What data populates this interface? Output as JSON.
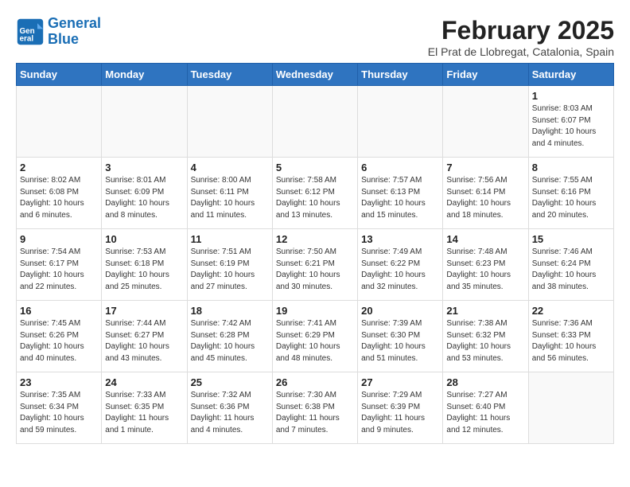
{
  "header": {
    "logo_line1": "General",
    "logo_line2": "Blue",
    "title": "February 2025",
    "subtitle": "El Prat de Llobregat, Catalonia, Spain"
  },
  "days_of_week": [
    "Sunday",
    "Monday",
    "Tuesday",
    "Wednesday",
    "Thursday",
    "Friday",
    "Saturday"
  ],
  "weeks": [
    [
      {
        "day": "",
        "info": ""
      },
      {
        "day": "",
        "info": ""
      },
      {
        "day": "",
        "info": ""
      },
      {
        "day": "",
        "info": ""
      },
      {
        "day": "",
        "info": ""
      },
      {
        "day": "",
        "info": ""
      },
      {
        "day": "1",
        "info": "Sunrise: 8:03 AM\nSunset: 6:07 PM\nDaylight: 10 hours\nand 4 minutes."
      }
    ],
    [
      {
        "day": "2",
        "info": "Sunrise: 8:02 AM\nSunset: 6:08 PM\nDaylight: 10 hours\nand 6 minutes."
      },
      {
        "day": "3",
        "info": "Sunrise: 8:01 AM\nSunset: 6:09 PM\nDaylight: 10 hours\nand 8 minutes."
      },
      {
        "day": "4",
        "info": "Sunrise: 8:00 AM\nSunset: 6:11 PM\nDaylight: 10 hours\nand 11 minutes."
      },
      {
        "day": "5",
        "info": "Sunrise: 7:58 AM\nSunset: 6:12 PM\nDaylight: 10 hours\nand 13 minutes."
      },
      {
        "day": "6",
        "info": "Sunrise: 7:57 AM\nSunset: 6:13 PM\nDaylight: 10 hours\nand 15 minutes."
      },
      {
        "day": "7",
        "info": "Sunrise: 7:56 AM\nSunset: 6:14 PM\nDaylight: 10 hours\nand 18 minutes."
      },
      {
        "day": "8",
        "info": "Sunrise: 7:55 AM\nSunset: 6:16 PM\nDaylight: 10 hours\nand 20 minutes."
      }
    ],
    [
      {
        "day": "9",
        "info": "Sunrise: 7:54 AM\nSunset: 6:17 PM\nDaylight: 10 hours\nand 22 minutes."
      },
      {
        "day": "10",
        "info": "Sunrise: 7:53 AM\nSunset: 6:18 PM\nDaylight: 10 hours\nand 25 minutes."
      },
      {
        "day": "11",
        "info": "Sunrise: 7:51 AM\nSunset: 6:19 PM\nDaylight: 10 hours\nand 27 minutes."
      },
      {
        "day": "12",
        "info": "Sunrise: 7:50 AM\nSunset: 6:21 PM\nDaylight: 10 hours\nand 30 minutes."
      },
      {
        "day": "13",
        "info": "Sunrise: 7:49 AM\nSunset: 6:22 PM\nDaylight: 10 hours\nand 32 minutes."
      },
      {
        "day": "14",
        "info": "Sunrise: 7:48 AM\nSunset: 6:23 PM\nDaylight: 10 hours\nand 35 minutes."
      },
      {
        "day": "15",
        "info": "Sunrise: 7:46 AM\nSunset: 6:24 PM\nDaylight: 10 hours\nand 38 minutes."
      }
    ],
    [
      {
        "day": "16",
        "info": "Sunrise: 7:45 AM\nSunset: 6:26 PM\nDaylight: 10 hours\nand 40 minutes."
      },
      {
        "day": "17",
        "info": "Sunrise: 7:44 AM\nSunset: 6:27 PM\nDaylight: 10 hours\nand 43 minutes."
      },
      {
        "day": "18",
        "info": "Sunrise: 7:42 AM\nSunset: 6:28 PM\nDaylight: 10 hours\nand 45 minutes."
      },
      {
        "day": "19",
        "info": "Sunrise: 7:41 AM\nSunset: 6:29 PM\nDaylight: 10 hours\nand 48 minutes."
      },
      {
        "day": "20",
        "info": "Sunrise: 7:39 AM\nSunset: 6:30 PM\nDaylight: 10 hours\nand 51 minutes."
      },
      {
        "day": "21",
        "info": "Sunrise: 7:38 AM\nSunset: 6:32 PM\nDaylight: 10 hours\nand 53 minutes."
      },
      {
        "day": "22",
        "info": "Sunrise: 7:36 AM\nSunset: 6:33 PM\nDaylight: 10 hours\nand 56 minutes."
      }
    ],
    [
      {
        "day": "23",
        "info": "Sunrise: 7:35 AM\nSunset: 6:34 PM\nDaylight: 10 hours\nand 59 minutes."
      },
      {
        "day": "24",
        "info": "Sunrise: 7:33 AM\nSunset: 6:35 PM\nDaylight: 11 hours\nand 1 minute."
      },
      {
        "day": "25",
        "info": "Sunrise: 7:32 AM\nSunset: 6:36 PM\nDaylight: 11 hours\nand 4 minutes."
      },
      {
        "day": "26",
        "info": "Sunrise: 7:30 AM\nSunset: 6:38 PM\nDaylight: 11 hours\nand 7 minutes."
      },
      {
        "day": "27",
        "info": "Sunrise: 7:29 AM\nSunset: 6:39 PM\nDaylight: 11 hours\nand 9 minutes."
      },
      {
        "day": "28",
        "info": "Sunrise: 7:27 AM\nSunset: 6:40 PM\nDaylight: 11 hours\nand 12 minutes."
      },
      {
        "day": "",
        "info": ""
      }
    ]
  ]
}
